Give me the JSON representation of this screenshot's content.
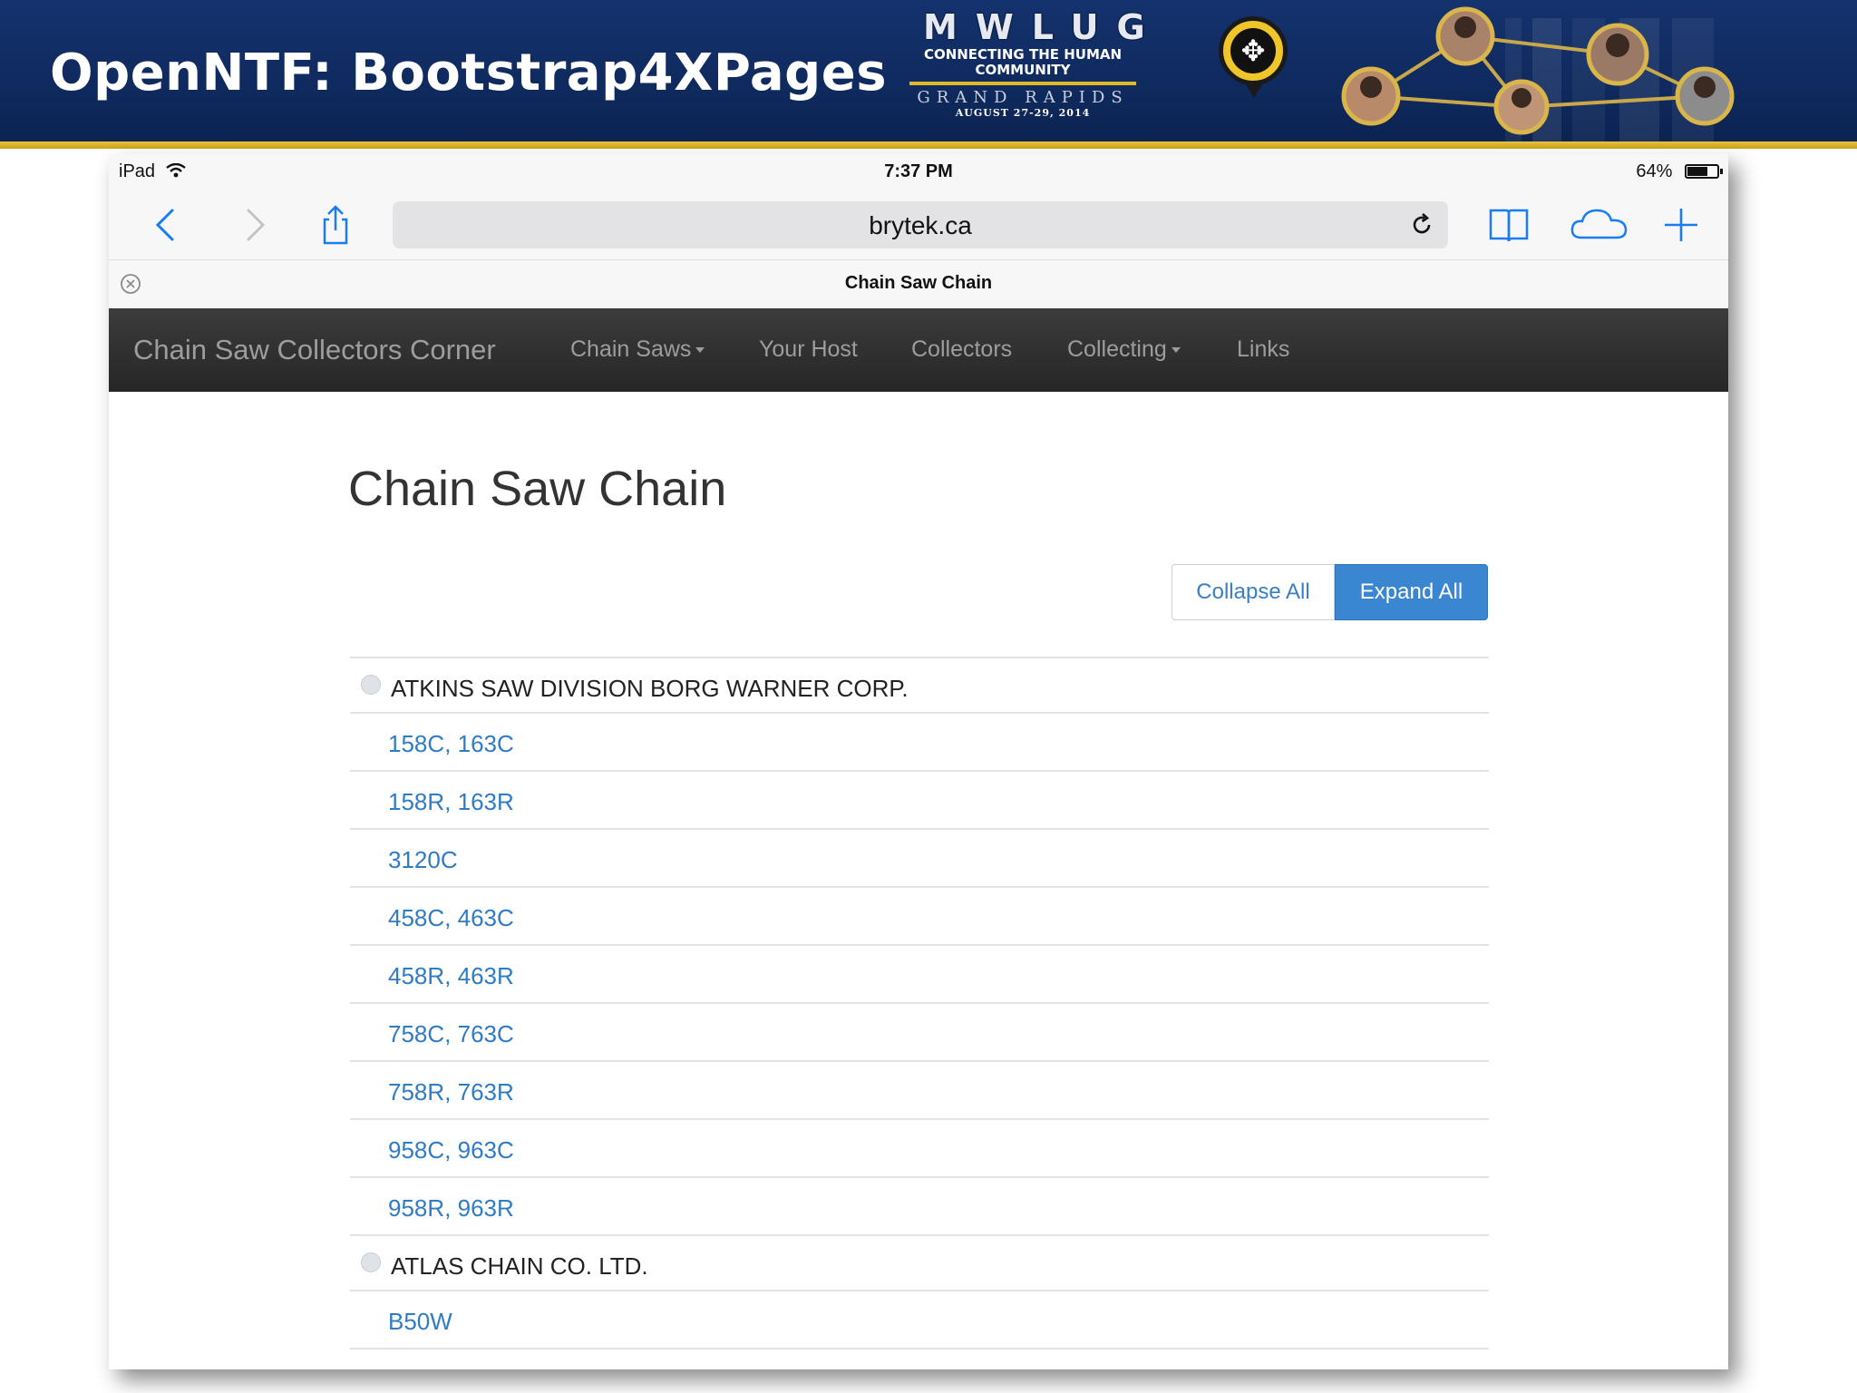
{
  "slide": {
    "title": "OpenNTF: Bootstrap4XPages",
    "logo": {
      "mark": "MWLUG",
      "tagline": "CONNECTING THE HUMAN COMMUNITY",
      "city": "GRAND RAPIDS",
      "dates": "AUGUST 27-29, 2014"
    },
    "colors": {
      "banner": "#0f2a5e",
      "rule": "#e0b82a"
    }
  },
  "ipad": {
    "status": {
      "device": "iPad",
      "time": "7:37 PM",
      "battery": "64%"
    },
    "battery_level": 0.64,
    "toolbar": {
      "url": "brytek.ca",
      "icons": [
        "back-icon",
        "forward-icon",
        "share-icon",
        "reload-icon",
        "bookmarks-icon",
        "icloud-tabs-icon",
        "new-tab-icon"
      ]
    },
    "tab": {
      "title": "Chain Saw Chain"
    }
  },
  "site": {
    "brand": "Chain Saw Collectors Corner",
    "nav": [
      {
        "label": "Chain Saws",
        "dropdown": true
      },
      {
        "label": "Your Host",
        "dropdown": false
      },
      {
        "label": "Collectors",
        "dropdown": false
      },
      {
        "label": "Collecting",
        "dropdown": true
      },
      {
        "label": "Links",
        "dropdown": false
      }
    ],
    "colors": {
      "navbar": "#2f2f2f",
      "link": "#2f7bc4",
      "primary_button": "#3a86d0"
    }
  },
  "page": {
    "title": "Chain Saw Chain",
    "buttons": {
      "collapse": "Collapse All",
      "expand": "Expand All"
    },
    "groups": [
      {
        "name": "ATKINS SAW DIVISION BORG WARNER CORP.",
        "items": [
          "158C, 163C",
          "158R, 163R",
          "3120C",
          "458C, 463C",
          "458R, 463R",
          "758C, 763C",
          "758R, 763R",
          "958C, 963C",
          "958R, 963R"
        ]
      },
      {
        "name": "ATLAS CHAIN CO. LTD.",
        "items": [
          "B50W"
        ]
      }
    ]
  }
}
